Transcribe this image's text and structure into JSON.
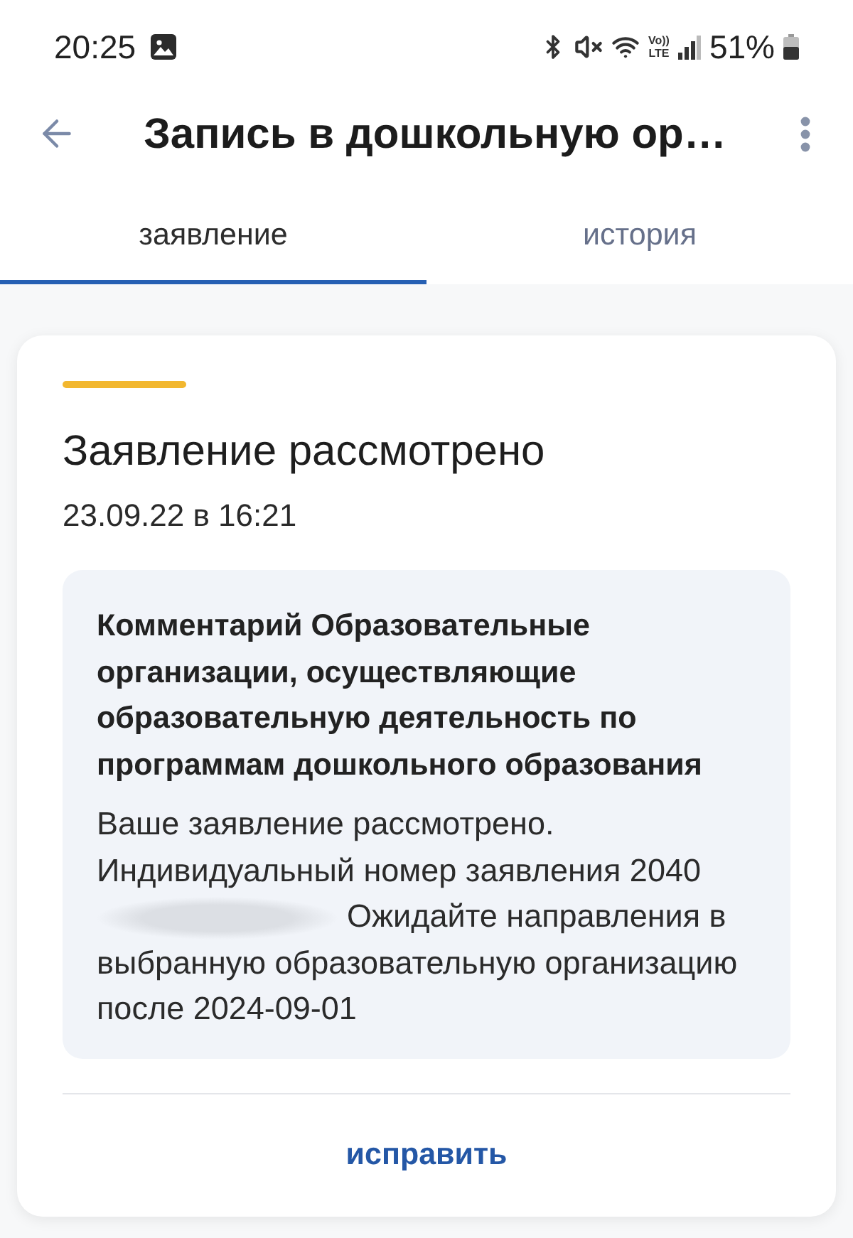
{
  "status_bar": {
    "time": "20:25",
    "network_badge": [
      "Vo))",
      "LTE"
    ],
    "battery": "51%"
  },
  "header": {
    "title": "Запись в дошкольную ор…"
  },
  "tabs": [
    {
      "label": "заявление",
      "selected": true
    },
    {
      "label": "история",
      "selected": false
    }
  ],
  "card": {
    "title": "Заявление рассмотрено",
    "date": "23.09.22 в 16:21",
    "comment": {
      "title": "Комментарий Образовательные организации, осуществляющие образовательную деятельность по программам дошкольного образования",
      "text_before": "Ваше заявление рассмотрено. Индивидуальный номер заявления 2040",
      "text_after": "Ожидайте направления в выбранную образовательную организацию после 2024-09-01"
    },
    "action": "исправить"
  }
}
